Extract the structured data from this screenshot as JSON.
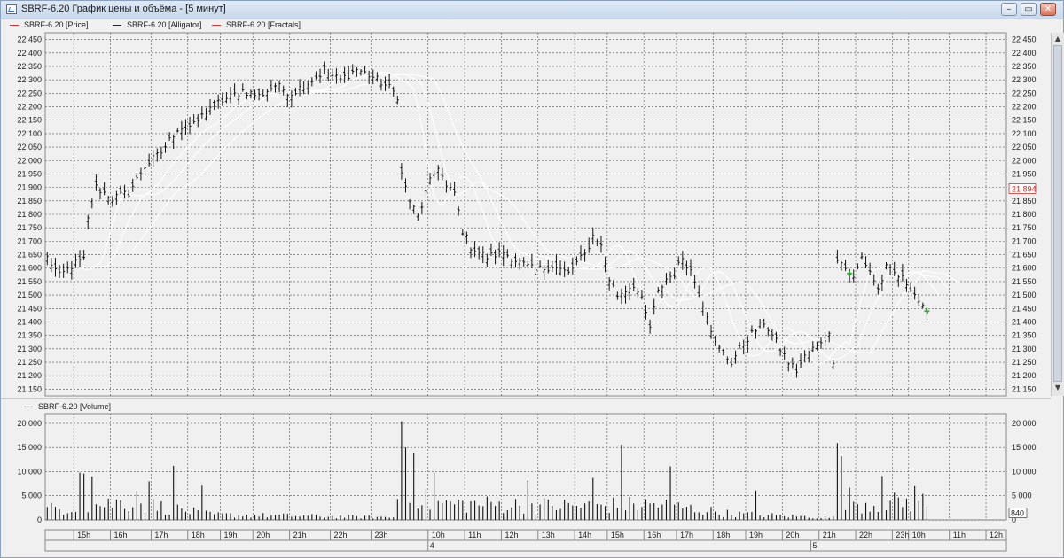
{
  "window": {
    "title": "SBRF-6.20 График цены и объёма - [5 минут]",
    "buttons": {
      "minimize": "–",
      "restore": "▭",
      "close": "✕"
    }
  },
  "legend_price": [
    {
      "label": "SBRF-6.20 [Price]",
      "color": "#cc3333"
    },
    {
      "label": "SBRF-6.20 [Alligator]",
      "color": "#222222"
    },
    {
      "label": "SBRF-6.20 [Fractals]",
      "color": "#cc3333"
    }
  ],
  "legend_volume": {
    "label": "SBRF-6.20 [Volume]",
    "color": "#222222"
  },
  "price_marker": {
    "label": "21 894",
    "value": 21894,
    "color": "#cc3333"
  },
  "volume_marker": {
    "label": "840",
    "value": 840
  },
  "day_labels": [
    {
      "label": "4",
      "index": 94
    },
    {
      "label": "5",
      "index": 188
    }
  ],
  "chart_data": [
    {
      "type": "ohlc",
      "title": "SBRF-6.20 [Price]",
      "ylim": [
        21125,
        22475
      ],
      "yticks": [
        21150,
        21200,
        21250,
        21300,
        21350,
        21400,
        21450,
        21500,
        21550,
        21600,
        21650,
        21700,
        21750,
        21800,
        21850,
        21900,
        21950,
        22000,
        22050,
        22100,
        22150,
        22200,
        22250,
        22300,
        22350,
        22400,
        22450
      ],
      "ytick_labels": [
        "21 150",
        "21 200",
        "21 250",
        "21 300",
        "21 350",
        "21 400",
        "21 450",
        "21 500",
        "21 550",
        "21 600",
        "21 650",
        "21 700",
        "21 750",
        "21 800",
        "21 850",
        "21 900",
        "21 950",
        "22 000",
        "22 050",
        "22 100",
        "22 150",
        "22 200",
        "22 250",
        "22 300",
        "22 350",
        "22 400",
        "22 450"
      ],
      "grid": true,
      "n_bars": 236,
      "x_labels": [
        {
          "label": "15h",
          "index": 7
        },
        {
          "label": "16h",
          "index": 16
        },
        {
          "label": "17h",
          "index": 26
        },
        {
          "label": "18h",
          "index": 35
        },
        {
          "label": "19h",
          "index": 43
        },
        {
          "label": "20h",
          "index": 51
        },
        {
          "label": "21h",
          "index": 60
        },
        {
          "label": "22h",
          "index": 70
        },
        {
          "label": "23h",
          "index": 80
        },
        {
          "label": "10h",
          "index": 94
        },
        {
          "label": "11h",
          "index": 103
        },
        {
          "label": "12h",
          "index": 112
        },
        {
          "label": "13h",
          "index": 121
        },
        {
          "label": "14h",
          "index": 130
        },
        {
          "label": "15h",
          "index": 138
        },
        {
          "label": "16h",
          "index": 147
        },
        {
          "label": "17h",
          "index": 155
        },
        {
          "label": "18h",
          "index": 164
        },
        {
          "label": "19h",
          "index": 172
        },
        {
          "label": "20h",
          "index": 181
        },
        {
          "label": "21h",
          "index": 190
        },
        {
          "label": "22h",
          "index": 199
        },
        {
          "label": "23h",
          "index": 208
        },
        {
          "label": "10h",
          "index": 212
        },
        {
          "label": "11h",
          "index": 222
        },
        {
          "label": "12h",
          "index": 231
        }
      ],
      "series": [
        {
          "name": "SBRF-6.20 [Price]",
          "anchors": [
            [
              0,
              21640
            ],
            [
              3,
              21570
            ],
            [
              7,
              21620
            ],
            [
              9,
              21630
            ],
            [
              10,
              21780
            ],
            [
              12,
              21900
            ],
            [
              16,
              21860
            ],
            [
              20,
              21880
            ],
            [
              24,
              21980
            ],
            [
              28,
              22030
            ],
            [
              32,
              22120
            ],
            [
              36,
              22130
            ],
            [
              40,
              22200
            ],
            [
              44,
              22230
            ],
            [
              48,
              22260
            ],
            [
              52,
              22240
            ],
            [
              56,
              22280
            ],
            [
              60,
              22250
            ],
            [
              64,
              22290
            ],
            [
              68,
              22330
            ],
            [
              72,
              22300
            ],
            [
              76,
              22340
            ],
            [
              80,
              22310
            ],
            [
              84,
              22270
            ],
            [
              86,
              22240
            ],
            [
              87,
              21950
            ],
            [
              89,
              21850
            ],
            [
              91,
              21790
            ],
            [
              94,
              21920
            ],
            [
              96,
              21980
            ],
            [
              98,
              21900
            ],
            [
              100,
              21880
            ],
            [
              102,
              21740
            ],
            [
              104,
              21680
            ],
            [
              108,
              21640
            ],
            [
              112,
              21660
            ],
            [
              116,
              21620
            ],
            [
              120,
              21590
            ],
            [
              124,
              21610
            ],
            [
              128,
              21580
            ],
            [
              130,
              21620
            ],
            [
              132,
              21650
            ],
            [
              134,
              21720
            ],
            [
              136,
              21680
            ],
            [
              138,
              21560
            ],
            [
              140,
              21500
            ],
            [
              144,
              21540
            ],
            [
              146,
              21480
            ],
            [
              148,
              21380
            ],
            [
              150,
              21510
            ],
            [
              152,
              21560
            ],
            [
              154,
              21580
            ],
            [
              156,
              21640
            ],
            [
              158,
              21590
            ],
            [
              160,
              21510
            ],
            [
              162,
              21430
            ],
            [
              164,
              21320
            ],
            [
              166,
              21280
            ],
            [
              168,
              21250
            ],
            [
              170,
              21300
            ],
            [
              172,
              21340
            ],
            [
              174,
              21370
            ],
            [
              176,
              21400
            ],
            [
              178,
              21350
            ],
            [
              180,
              21300
            ],
            [
              182,
              21250
            ],
            [
              184,
              21220
            ],
            [
              186,
              21270
            ],
            [
              188,
              21300
            ],
            [
              190,
              21330
            ],
            [
              192,
              21350
            ],
            [
              193,
              21260
            ],
            [
              194,
              21640
            ],
            [
              196,
              21600
            ],
            [
              198,
              21560
            ],
            [
              200,
              21640
            ],
            [
              202,
              21590
            ],
            [
              204,
              21520
            ],
            [
              206,
              21600
            ],
            [
              208,
              21580
            ],
            [
              210,
              21560
            ],
            [
              212,
              21530
            ],
            [
              214,
              21480
            ],
            [
              216,
              21420
            ]
          ]
        },
        {
          "name": "SBRF-6.20 [Alligator]"
        },
        {
          "name": "SBRF-6.20 [Fractals]"
        }
      ]
    },
    {
      "type": "bar",
      "title": "SBRF-6.20 [Volume]",
      "ylim": [
        0,
        22000
      ],
      "yticks": [
        0,
        5000,
        10000,
        15000,
        20000
      ],
      "ytick_labels": [
        "0",
        "5 000",
        "10 000",
        "15 000",
        "20 000"
      ],
      "grid": true,
      "spikes": [
        [
          8,
          9800
        ],
        [
          9,
          9600
        ],
        [
          11,
          9000
        ],
        [
          22,
          6000
        ],
        [
          25,
          8000
        ],
        [
          31,
          11200
        ],
        [
          38,
          7100
        ],
        [
          87,
          20400
        ],
        [
          88,
          15000
        ],
        [
          90,
          13800
        ],
        [
          95,
          9800
        ],
        [
          118,
          8200
        ],
        [
          134,
          8700
        ],
        [
          141,
          15600
        ],
        [
          153,
          11100
        ],
        [
          174,
          6100
        ],
        [
          194,
          15900
        ],
        [
          195,
          13200
        ],
        [
          205,
          9100
        ],
        [
          213,
          7000
        ]
      ],
      "base_levels": [
        [
          0,
          2500
        ],
        [
          12,
          3500
        ],
        [
          20,
          4200
        ],
        [
          40,
          1200
        ],
        [
          85,
          600
        ],
        [
          87,
          9000
        ],
        [
          94,
          3800
        ],
        [
          130,
          3200
        ],
        [
          150,
          3600
        ],
        [
          168,
          1400
        ],
        [
          193,
          500
        ],
        [
          194,
          6000
        ],
        [
          200,
          3800
        ],
        [
          216,
          4200
        ]
      ]
    }
  ]
}
